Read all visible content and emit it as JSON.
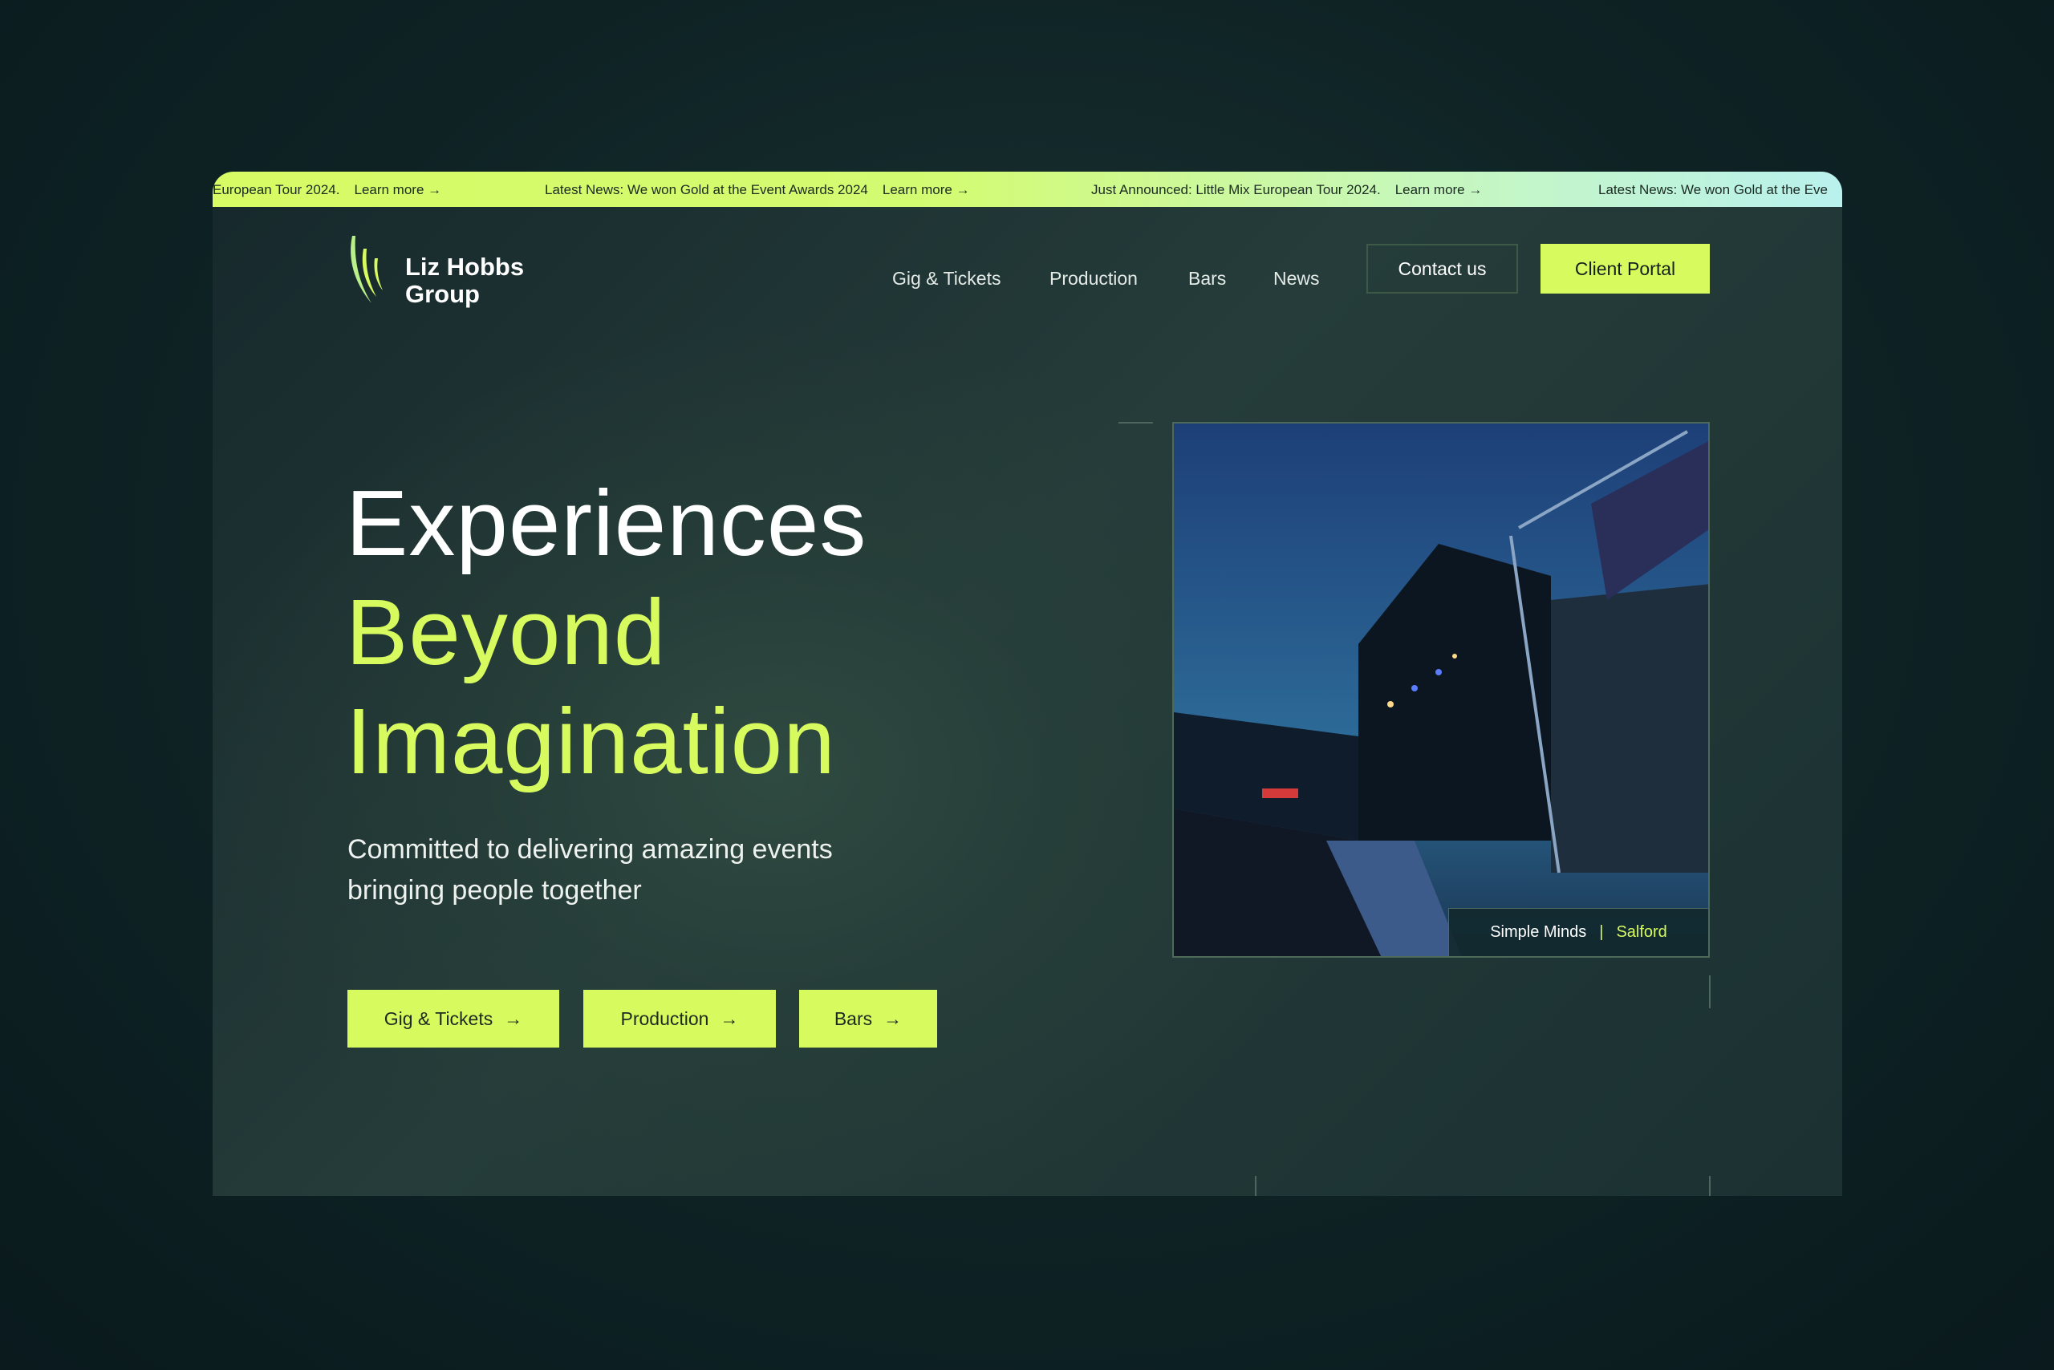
{
  "ticker": [
    {
      "text": "European Tour 2024.",
      "link": "Learn more"
    },
    {
      "text": "Latest News: We won Gold at the Event Awards 2024",
      "link": "Learn more"
    },
    {
      "text": "Just Announced: Little Mix European Tour 2024.",
      "link": "Learn more"
    },
    {
      "text": "Latest News: We won Gold at the Eve",
      "link": ""
    }
  ],
  "logo": {
    "line1": "Liz Hobbs",
    "line2": "Group"
  },
  "nav": {
    "items": [
      "Gig & Tickets",
      "Production",
      "Bars",
      "News"
    ],
    "contact": "Contact us",
    "portal": "Client Portal"
  },
  "hero": {
    "line1": "Experiences",
    "line2": "Beyond",
    "line3": "Imagination",
    "subtitle1": "Committed to delivering amazing events",
    "subtitle2": "bringing people together",
    "buttons": [
      "Gig & Tickets",
      "Production",
      "Bars"
    ]
  },
  "photo": {
    "artist": "Simple Minds",
    "separator": "|",
    "location": "Salford"
  },
  "colors": {
    "accent": "#d7fa5f",
    "background": "#0e2224"
  }
}
